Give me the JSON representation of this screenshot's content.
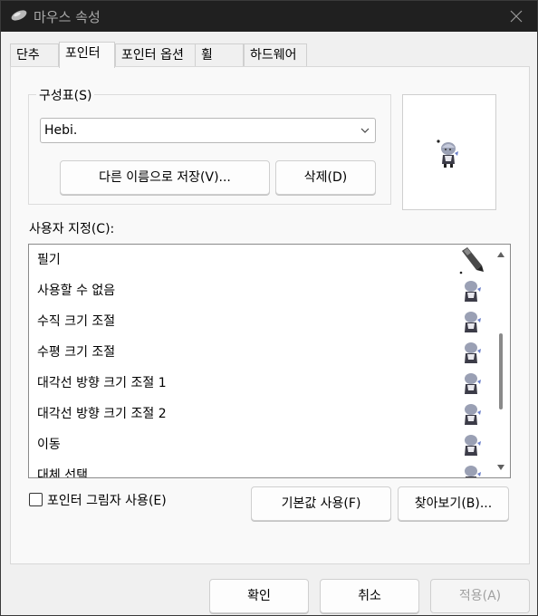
{
  "window": {
    "title": "마우스 속성"
  },
  "tabs": [
    {
      "label": "단추"
    },
    {
      "label": "포인터"
    },
    {
      "label": "포인터 옵션"
    },
    {
      "label": "휠"
    },
    {
      "label": "하드웨어"
    }
  ],
  "active_tab": "포인터",
  "scheme": {
    "group_label": "구성표(S)",
    "selected_value": "Hebi.",
    "save_as_label": "다른 이름으로 저장(V)...",
    "delete_label": "삭제(D)"
  },
  "customize": {
    "label": "사용자 지정(C):",
    "items": [
      {
        "label": "필기",
        "icon": "pen-cursor-icon"
      },
      {
        "label": "사용할 수 없음",
        "icon": "character-cursor-icon"
      },
      {
        "label": "수직 크기 조절",
        "icon": "character-cursor-icon"
      },
      {
        "label": "수평 크기 조절",
        "icon": "character-cursor-icon"
      },
      {
        "label": "대각선 방향 크기 조절 1",
        "icon": "character-cursor-icon"
      },
      {
        "label": "대각선 방향 크기 조절 2",
        "icon": "character-cursor-icon"
      },
      {
        "label": "이동",
        "icon": "character-cursor-icon"
      },
      {
        "label": "대체 선택",
        "icon": "character-cursor-icon"
      }
    ],
    "scroll_position": 0.45
  },
  "shadow": {
    "label": "포인터 그림자 사용(E)",
    "checked": false
  },
  "buttons": {
    "use_default": "기본값 사용(F)",
    "browse": "찾아보기(B)...",
    "ok": "확인",
    "cancel": "취소",
    "apply": "적용(A)"
  },
  "colors": {
    "titlebar": "#202020",
    "panel": "#f9f9f9",
    "dialog": "#f0f0f0",
    "disabled_text": "#a0a0a0",
    "character_hair": "#9aa0b4",
    "character_ribbon": "#6a7ec8"
  }
}
